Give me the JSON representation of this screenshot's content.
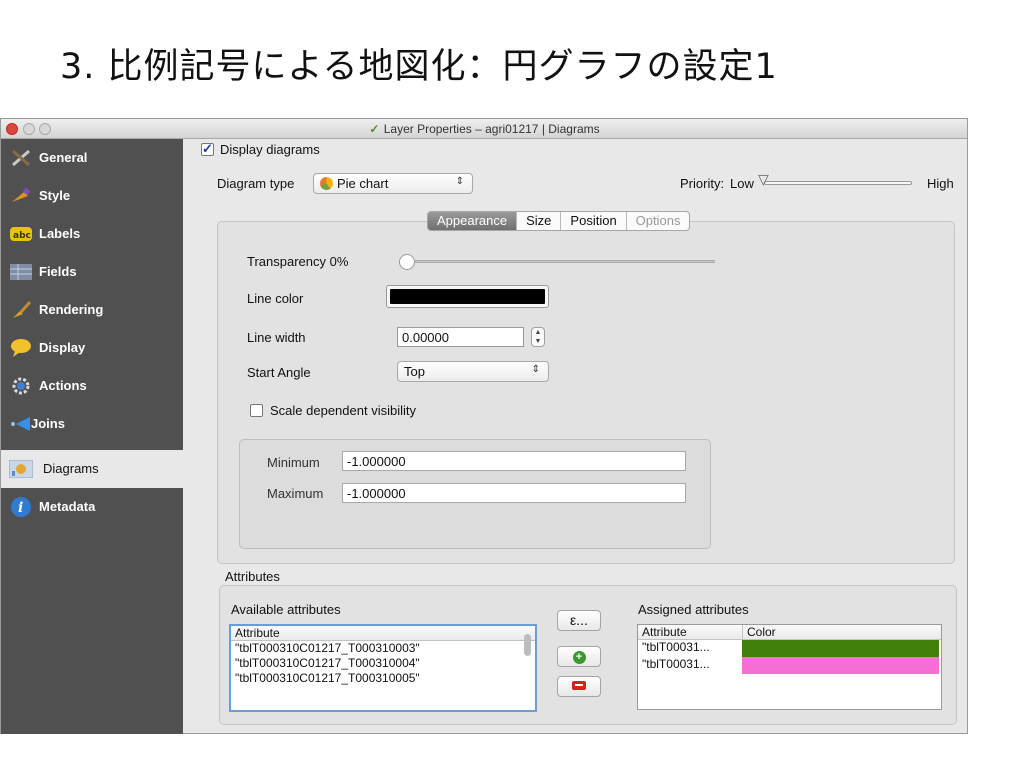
{
  "slide": {
    "title": "3. 比例記号による地図化：円グラフの設定1"
  },
  "window": {
    "title": "Layer Properties – agri01217 | Diagrams"
  },
  "sidebar": {
    "items": [
      {
        "label": "General",
        "icon": "tools-icon"
      },
      {
        "label": "Style",
        "icon": "paintbrush-icon"
      },
      {
        "label": "Labels",
        "icon": "abc-label-icon"
      },
      {
        "label": "Fields",
        "icon": "table-icon"
      },
      {
        "label": "Rendering",
        "icon": "brush-icon"
      },
      {
        "label": "Display",
        "icon": "speech-bubble-icon"
      },
      {
        "label": "Actions",
        "icon": "gear-play-icon"
      },
      {
        "label": "Joins",
        "icon": "join-arrow-icon"
      },
      {
        "label": "Diagrams",
        "icon": "diagram-icon"
      },
      {
        "label": "Metadata",
        "icon": "info-icon"
      }
    ],
    "active": "Diagrams"
  },
  "main": {
    "display_diagrams_label": "Display diagrams",
    "display_diagrams_checked": true,
    "diagram_type_label": "Diagram type",
    "diagram_type_value": "Pie chart",
    "priority_label": "Priority:",
    "priority_low": "Low",
    "priority_high": "High",
    "tabs": [
      "Appearance",
      "Size",
      "Position",
      "Options"
    ],
    "active_tab": "Appearance",
    "transparency_label": "Transparency 0%",
    "transparency_value": 0,
    "line_color_label": "Line color",
    "line_color": "#000000",
    "line_width_label": "Line width",
    "line_width_value": "0.00000",
    "start_angle_label": "Start Angle",
    "start_angle_value": "Top",
    "scale_visibility_label": "Scale dependent visibility",
    "scale_visibility_checked": false,
    "minimum_label": "Minimum",
    "minimum_value": "-1.000000",
    "maximum_label": "Maximum",
    "maximum_value": "-1.000000"
  },
  "attributes": {
    "section_label": "Attributes",
    "available_label": "Available attributes",
    "available_header": "Attribute",
    "available_rows": [
      "\"tblT000310C01217_T000310003\"",
      "\"tblT000310C01217_T000310004\"",
      "\"tblT000310C01217_T000310005\""
    ],
    "expression_button": "ε...",
    "assigned_label": "Assigned attributes",
    "assigned_headers": [
      "Attribute",
      "Color"
    ],
    "assigned_rows": [
      {
        "attribute": "\"tblT00031...",
        "color": "#3f7f0a"
      },
      {
        "attribute": "\"tblT00031...",
        "color": "#f56fd2"
      }
    ]
  }
}
